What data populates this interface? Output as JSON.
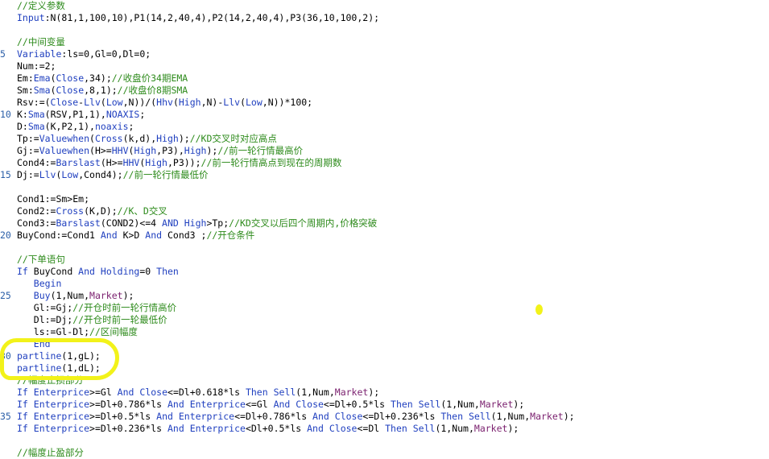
{
  "colors": {
    "comment": "#2e8b1c",
    "keyword": "#1f3fbf",
    "param": "#7a1f6e",
    "line_number": "#2b5fa8",
    "highlight": "#f2f21a"
  },
  "lines": [
    {
      "n": "",
      "parts": [
        [
          "c",
          "//定义参数"
        ]
      ]
    },
    {
      "n": "",
      "parts": [
        [
          "k",
          "Input"
        ],
        [
          "n",
          ":N(81,1,100,10),P1(14,2,40,4),P2(14,2,40,4),P3(36,10,100,2);"
        ]
      ]
    },
    {
      "n": "",
      "parts": []
    },
    {
      "n": "",
      "parts": [
        [
          "c",
          "//中间变量"
        ]
      ]
    },
    {
      "n": "5",
      "parts": [
        [
          "k",
          "Variable"
        ],
        [
          "n",
          ":ls=0,Gl=0,Dl=0;"
        ]
      ]
    },
    {
      "n": "",
      "parts": [
        [
          "n",
          "Num:=2;"
        ]
      ]
    },
    {
      "n": "",
      "parts": [
        [
          "n",
          "Em:"
        ],
        [
          "k",
          "Ema"
        ],
        [
          "n",
          "("
        ],
        [
          "k",
          "Close"
        ],
        [
          "n",
          ",34);"
        ],
        [
          "c",
          "//收盘价34期EMA"
        ]
      ]
    },
    {
      "n": "",
      "parts": [
        [
          "n",
          "Sm:"
        ],
        [
          "k",
          "Sma"
        ],
        [
          "n",
          "("
        ],
        [
          "k",
          "Close"
        ],
        [
          "n",
          ",8,1);"
        ],
        [
          "c",
          "//收盘价8期SMA"
        ]
      ]
    },
    {
      "n": "",
      "parts": [
        [
          "n",
          "Rsv:=("
        ],
        [
          "k",
          "Close"
        ],
        [
          "n",
          "-"
        ],
        [
          "k",
          "Llv"
        ],
        [
          "n",
          "("
        ],
        [
          "k",
          "Low"
        ],
        [
          "n",
          ",N))/("
        ],
        [
          "k",
          "Hhv"
        ],
        [
          "n",
          "("
        ],
        [
          "k",
          "High"
        ],
        [
          "n",
          ",N)-"
        ],
        [
          "k",
          "Llv"
        ],
        [
          "n",
          "("
        ],
        [
          "k",
          "Low"
        ],
        [
          "n",
          ",N))*100;"
        ]
      ]
    },
    {
      "n": "10",
      "parts": [
        [
          "n",
          "K:"
        ],
        [
          "k",
          "Sma"
        ],
        [
          "n",
          "(RSV,P1,1),"
        ],
        [
          "k",
          "NOAXIS"
        ],
        [
          "n",
          ";"
        ]
      ]
    },
    {
      "n": "",
      "parts": [
        [
          "n",
          "D:"
        ],
        [
          "k",
          "Sma"
        ],
        [
          "n",
          "(K,P2,1),"
        ],
        [
          "k",
          "noaxis"
        ],
        [
          "n",
          ";"
        ]
      ]
    },
    {
      "n": "",
      "parts": [
        [
          "n",
          "Tp:="
        ],
        [
          "k",
          "Valuewhen"
        ],
        [
          "n",
          "("
        ],
        [
          "k",
          "Cross"
        ],
        [
          "n",
          "(k,d),"
        ],
        [
          "k",
          "High"
        ],
        [
          "n",
          ");"
        ],
        [
          "c",
          "//KD交叉时对应高点"
        ]
      ]
    },
    {
      "n": "",
      "parts": [
        [
          "n",
          "Gj:="
        ],
        [
          "k",
          "Valuewhen"
        ],
        [
          "n",
          "(H>="
        ],
        [
          "k",
          "HHV"
        ],
        [
          "n",
          "("
        ],
        [
          "k",
          "High"
        ],
        [
          "n",
          ",P3),"
        ],
        [
          "k",
          "High"
        ],
        [
          "n",
          ");"
        ],
        [
          "c",
          "//前一轮行情最高价"
        ]
      ]
    },
    {
      "n": "",
      "parts": [
        [
          "n",
          "Cond4:="
        ],
        [
          "k",
          "Barslast"
        ],
        [
          "n",
          "(H>="
        ],
        [
          "k",
          "HHV"
        ],
        [
          "n",
          "("
        ],
        [
          "k",
          "High"
        ],
        [
          "n",
          ",P3));"
        ],
        [
          "c",
          "//前一轮行情高点到现在的周期数"
        ]
      ]
    },
    {
      "n": "15",
      "parts": [
        [
          "n",
          "Dj:="
        ],
        [
          "k",
          "Llv"
        ],
        [
          "n",
          "("
        ],
        [
          "k",
          "Low"
        ],
        [
          "n",
          ",Cond4);"
        ],
        [
          "c",
          "//前一轮行情最低价"
        ]
      ]
    },
    {
      "n": "",
      "parts": []
    },
    {
      "n": "",
      "parts": [
        [
          "n",
          "Cond1:=Sm>Em;"
        ]
      ]
    },
    {
      "n": "",
      "parts": [
        [
          "n",
          "Cond2:="
        ],
        [
          "k",
          "Cross"
        ],
        [
          "n",
          "(K,D);"
        ],
        [
          "c",
          "//K、D交叉"
        ]
      ]
    },
    {
      "n": "",
      "parts": [
        [
          "n",
          "Cond3:="
        ],
        [
          "k",
          "Barslast"
        ],
        [
          "n",
          "(COND2)<=4 "
        ],
        [
          "k",
          "AND"
        ],
        [
          "n",
          " "
        ],
        [
          "k",
          "High"
        ],
        [
          "n",
          ">Tp;"
        ],
        [
          "c",
          "//KD交叉以后四个周期内,价格突破"
        ]
      ]
    },
    {
      "n": "20",
      "parts": [
        [
          "n",
          "BuyCond:=Cond1 "
        ],
        [
          "k",
          "And"
        ],
        [
          "n",
          " K>D "
        ],
        [
          "k",
          "And"
        ],
        [
          "n",
          " Cond3 ;"
        ],
        [
          "c",
          "//开仓条件"
        ]
      ]
    },
    {
      "n": "",
      "parts": []
    },
    {
      "n": "",
      "parts": [
        [
          "c",
          "//下单语句"
        ]
      ]
    },
    {
      "n": "",
      "parts": [
        [
          "k",
          "If"
        ],
        [
          "n",
          " BuyCond "
        ],
        [
          "k",
          "And"
        ],
        [
          "n",
          " "
        ],
        [
          "k",
          "Holding"
        ],
        [
          "n",
          "=0 "
        ],
        [
          "k",
          "Then"
        ]
      ]
    },
    {
      "n": "",
      "parts": [
        [
          "n",
          "   "
        ],
        [
          "k",
          "Begin"
        ]
      ]
    },
    {
      "n": "25",
      "parts": [
        [
          "n",
          "   "
        ],
        [
          "k",
          "Buy"
        ],
        [
          "n",
          "(1,Num,"
        ],
        [
          "p",
          "Market"
        ],
        [
          "n",
          ");"
        ]
      ]
    },
    {
      "n": "",
      "parts": [
        [
          "n",
          "   Gl:=Gj;"
        ],
        [
          "c",
          "//开仓时前一轮行情高价"
        ]
      ]
    },
    {
      "n": "",
      "parts": [
        [
          "n",
          "   Dl:=Dj;"
        ],
        [
          "c",
          "//开仓时前一轮最低价"
        ]
      ]
    },
    {
      "n": "",
      "parts": [
        [
          "n",
          "   ls:=Gl-Dl;"
        ],
        [
          "c",
          "//区间幅度"
        ]
      ]
    },
    {
      "n": "",
      "parts": [
        [
          "n",
          "   "
        ],
        [
          "k",
          "End"
        ]
      ]
    },
    {
      "n": "30",
      "parts": [
        [
          "k",
          "partline"
        ],
        [
          "n",
          "(1,gL);"
        ]
      ]
    },
    {
      "n": "",
      "parts": [
        [
          "k",
          "partline"
        ],
        [
          "n",
          "(1,dL);"
        ]
      ]
    },
    {
      "n": "",
      "parts": [
        [
          "c",
          "//幅度止损部分"
        ]
      ]
    },
    {
      "n": "",
      "parts": [
        [
          "k",
          "If"
        ],
        [
          "n",
          " "
        ],
        [
          "k",
          "Enterprice"
        ],
        [
          "n",
          ">=Gl "
        ],
        [
          "k",
          "And"
        ],
        [
          "n",
          " "
        ],
        [
          "k",
          "Close"
        ],
        [
          "n",
          "<=Dl+0.618*ls "
        ],
        [
          "k",
          "Then"
        ],
        [
          "n",
          " "
        ],
        [
          "k",
          "Sell"
        ],
        [
          "n",
          "(1,Num,"
        ],
        [
          "p",
          "Market"
        ],
        [
          "n",
          ");"
        ]
      ]
    },
    {
      "n": "",
      "parts": [
        [
          "k",
          "If"
        ],
        [
          "n",
          " "
        ],
        [
          "k",
          "Enterprice"
        ],
        [
          "n",
          ">=Dl+0.786*ls "
        ],
        [
          "k",
          "And"
        ],
        [
          "n",
          " "
        ],
        [
          "k",
          "Enterprice"
        ],
        [
          "n",
          "<=Gl "
        ],
        [
          "k",
          "And"
        ],
        [
          "n",
          " "
        ],
        [
          "k",
          "Close"
        ],
        [
          "n",
          "<=Dl+0.5*ls "
        ],
        [
          "k",
          "Then"
        ],
        [
          "n",
          " "
        ],
        [
          "k",
          "Sell"
        ],
        [
          "n",
          "(1,Num,"
        ],
        [
          "p",
          "Market"
        ],
        [
          "n",
          ");"
        ]
      ]
    },
    {
      "n": "35",
      "parts": [
        [
          "k",
          "If"
        ],
        [
          "n",
          " "
        ],
        [
          "k",
          "Enterprice"
        ],
        [
          "n",
          ">=Dl+0.5*ls "
        ],
        [
          "k",
          "And"
        ],
        [
          "n",
          " "
        ],
        [
          "k",
          "Enterprice"
        ],
        [
          "n",
          "<=Dl+0.786*ls "
        ],
        [
          "k",
          "And"
        ],
        [
          "n",
          " "
        ],
        [
          "k",
          "Close"
        ],
        [
          "n",
          "<=Dl+0.236*ls "
        ],
        [
          "k",
          "Then"
        ],
        [
          "n",
          " "
        ],
        [
          "k",
          "Sell"
        ],
        [
          "n",
          "(1,Num,"
        ],
        [
          "p",
          "Market"
        ],
        [
          "n",
          ");"
        ]
      ]
    },
    {
      "n": "",
      "parts": [
        [
          "k",
          "If"
        ],
        [
          "n",
          " "
        ],
        [
          "k",
          "Enterprice"
        ],
        [
          "n",
          ">=Dl+0.236*ls "
        ],
        [
          "k",
          "And"
        ],
        [
          "n",
          " "
        ],
        [
          "k",
          "Enterprice"
        ],
        [
          "n",
          "<Dl+0.5*ls "
        ],
        [
          "k",
          "And"
        ],
        [
          "n",
          " "
        ],
        [
          "k",
          "Close"
        ],
        [
          "n",
          "<=Dl "
        ],
        [
          "k",
          "Then"
        ],
        [
          "n",
          " "
        ],
        [
          "k",
          "Sell"
        ],
        [
          "n",
          "(1,Num,"
        ],
        [
          "p",
          "Market"
        ],
        [
          "n",
          ");"
        ]
      ]
    },
    {
      "n": "",
      "parts": []
    },
    {
      "n": "",
      "parts": [
        [
          "c",
          "//幅度止盈部分"
        ]
      ]
    }
  ]
}
